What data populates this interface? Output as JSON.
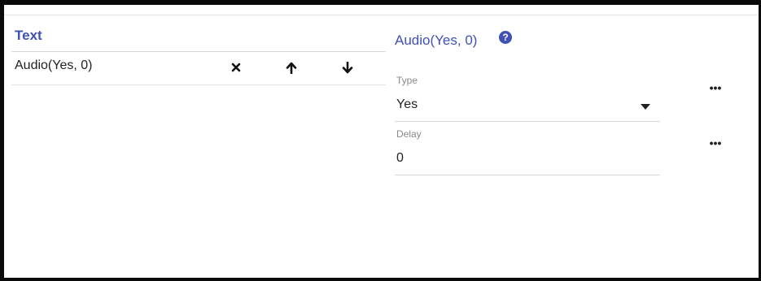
{
  "list_panel": {
    "header": "Text",
    "rows": [
      {
        "label": "Audio(Yes, 0)"
      }
    ],
    "actions": {
      "delete_icon": "close-icon",
      "up_icon": "arrow-up-icon",
      "down_icon": "arrow-down-icon"
    }
  },
  "details_panel": {
    "title": "Audio(Yes, 0)",
    "help_icon": "question-circle-icon",
    "help_glyph": "?",
    "fields": [
      {
        "label": "Type",
        "value": "Yes",
        "kind": "select"
      },
      {
        "label": "Delay",
        "value": "0",
        "kind": "text"
      }
    ],
    "more_glyph": "•••"
  },
  "colors": {
    "accent": "#3f51b5",
    "frame": "#0a0a0a",
    "divider": "#d9d9d9"
  }
}
